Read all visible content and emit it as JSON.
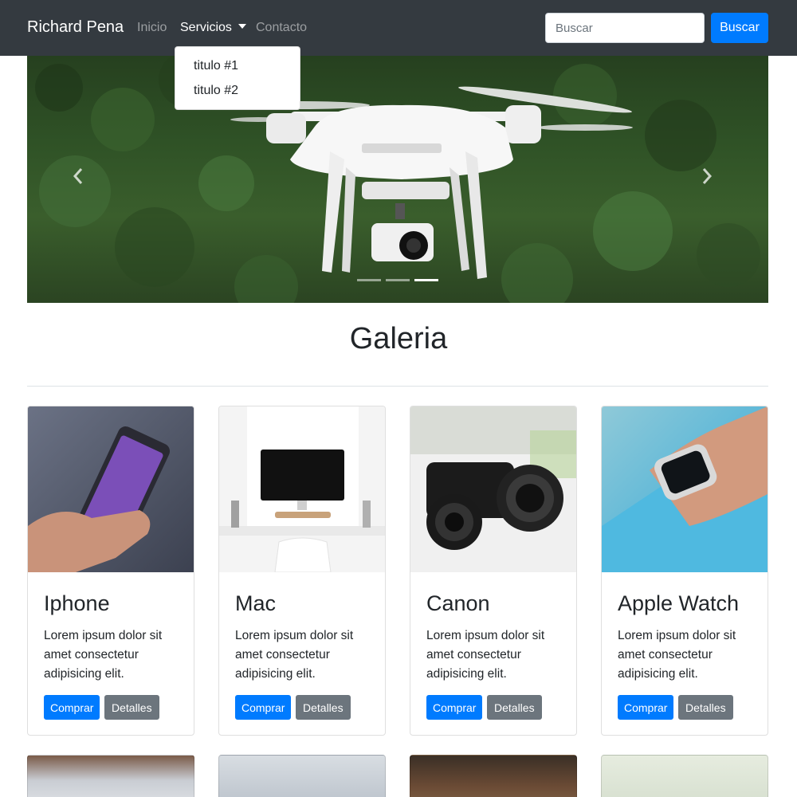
{
  "navbar": {
    "brand": "Richard Pena",
    "links": [
      {
        "label": "Inicio"
      },
      {
        "label": "Servicios"
      },
      {
        "label": "Contacto"
      }
    ],
    "search": {
      "placeholder": "Buscar",
      "button_label": "Buscar"
    }
  },
  "dropdown": {
    "items": [
      {
        "label": "titulo #1"
      },
      {
        "label": "titulo #2"
      }
    ]
  },
  "carousel": {
    "slide_count": 3,
    "active_slide": 3,
    "prev_icon": "chevron-left-icon",
    "next_icon": "chevron-right-icon"
  },
  "gallery": {
    "title": "Galeria",
    "cards": [
      {
        "title": "Iphone",
        "text": "Lorem ipsum dolor sit amet consectetur adipisicing elit.",
        "buy_label": "Comprar",
        "details_label": "Detalles"
      },
      {
        "title": "Mac",
        "text": "Lorem ipsum dolor sit amet consectetur adipisicing elit.",
        "buy_label": "Comprar",
        "details_label": "Detalles"
      },
      {
        "title": "Canon",
        "text": "Lorem ipsum dolor sit amet consectetur adipisicing elit.",
        "buy_label": "Comprar",
        "details_label": "Detalles"
      },
      {
        "title": "Apple Watch",
        "text": "Lorem ipsum dolor sit amet consectetur adipisicing elit.",
        "buy_label": "Comprar",
        "details_label": "Detalles"
      }
    ]
  },
  "colors": {
    "navbar_bg": "#343a40",
    "primary": "#007bff",
    "secondary": "#6c757d"
  }
}
